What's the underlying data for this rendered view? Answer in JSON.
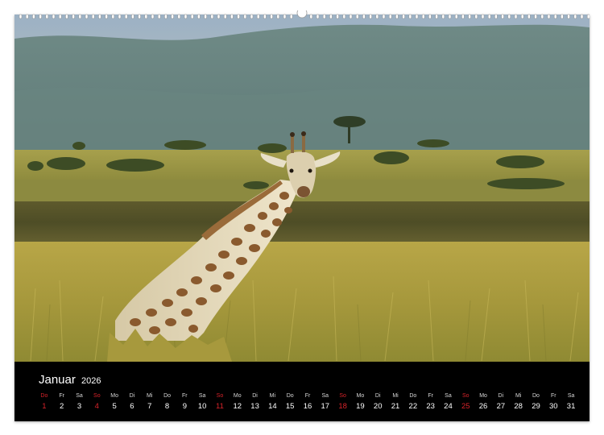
{
  "calendar": {
    "month": "Januar",
    "year": "2026",
    "days": [
      {
        "wd": "Do",
        "n": "1",
        "sunday": true
      },
      {
        "wd": "Fr",
        "n": "2"
      },
      {
        "wd": "Sa",
        "n": "3"
      },
      {
        "wd": "So",
        "n": "4",
        "sunday": true
      },
      {
        "wd": "Mo",
        "n": "5"
      },
      {
        "wd": "Di",
        "n": "6"
      },
      {
        "wd": "Mi",
        "n": "7"
      },
      {
        "wd": "Do",
        "n": "8"
      },
      {
        "wd": "Fr",
        "n": "9"
      },
      {
        "wd": "Sa",
        "n": "10"
      },
      {
        "wd": "So",
        "n": "11",
        "sunday": true
      },
      {
        "wd": "Mo",
        "n": "12"
      },
      {
        "wd": "Di",
        "n": "13"
      },
      {
        "wd": "Mi",
        "n": "14"
      },
      {
        "wd": "Do",
        "n": "15"
      },
      {
        "wd": "Fr",
        "n": "16"
      },
      {
        "wd": "Sa",
        "n": "17"
      },
      {
        "wd": "So",
        "n": "18",
        "sunday": true
      },
      {
        "wd": "Mo",
        "n": "19"
      },
      {
        "wd": "Di",
        "n": "20"
      },
      {
        "wd": "Mi",
        "n": "21"
      },
      {
        "wd": "Do",
        "n": "22"
      },
      {
        "wd": "Fr",
        "n": "23"
      },
      {
        "wd": "Sa",
        "n": "24"
      },
      {
        "wd": "So",
        "n": "25",
        "sunday": true
      },
      {
        "wd": "Mo",
        "n": "26"
      },
      {
        "wd": "Di",
        "n": "27"
      },
      {
        "wd": "Mi",
        "n": "28"
      },
      {
        "wd": "Do",
        "n": "29"
      },
      {
        "wd": "Fr",
        "n": "30"
      },
      {
        "wd": "Sa",
        "n": "31"
      }
    ]
  },
  "colors": {
    "sunday": "#d8232a",
    "calendar_bar": "#000000"
  }
}
